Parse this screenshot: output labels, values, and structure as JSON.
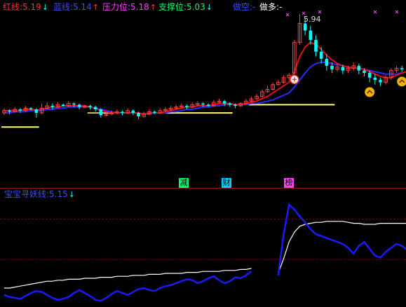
{
  "top_legend": {
    "red_line": {
      "label": "红线:",
      "value": "5.19",
      "arrow": "↓",
      "color": "#ff3030"
    },
    "blue_line": {
      "label": "蓝线:",
      "value": "5.14",
      "arrow": "↑",
      "color": "#3b4bff"
    },
    "resistance": {
      "label": "压力位:",
      "value": "5.18",
      "arrow": "↑",
      "color": "#ff40ff"
    },
    "support": {
      "label": "支撑位:",
      "value": "5.03",
      "arrow": "↓",
      "color": "#00ff66"
    },
    "short": {
      "label": "做空:",
      "value": "-",
      "color": "#3b4bff"
    },
    "long": {
      "label": "做多:",
      "value": "-",
      "color": "#ffffff"
    }
  },
  "peak_price": "5.94",
  "tags": [
    {
      "text": "减",
      "bg": "#00ff66"
    },
    {
      "text": "财",
      "bg": "#00cfff"
    },
    {
      "text": "榜",
      "bg": "#ff40ff"
    }
  ],
  "sub_legend": {
    "label": "宝宝寻妖线:",
    "value": "5.15",
    "arrow": "↓",
    "color": "#00ffff"
  },
  "colors": {
    "background": "#000000",
    "divider": "#8a1a1a",
    "up": "#ff4040",
    "down": "#00ffff",
    "flat": "#ffffff"
  },
  "chart_data": {
    "type": "candlestick",
    "title": "",
    "xlabel": "",
    "ylabel": "",
    "ylim": [
      4.6,
      6.0
    ],
    "candles": [
      {
        "o": 5.1,
        "c": 5.12,
        "h": 5.14,
        "l": 5.08
      },
      {
        "o": 5.12,
        "c": 5.11,
        "h": 5.13,
        "l": 5.09
      },
      {
        "o": 5.11,
        "c": 5.13,
        "h": 5.15,
        "l": 5.1
      },
      {
        "o": 5.13,
        "c": 5.12,
        "h": 5.14,
        "l": 5.1
      },
      {
        "o": 5.12,
        "c": 5.14,
        "h": 5.16,
        "l": 5.11
      },
      {
        "o": 5.14,
        "c": 5.13,
        "h": 5.15,
        "l": 5.12
      },
      {
        "o": 5.13,
        "c": 5.1,
        "h": 5.14,
        "l": 5.06
      },
      {
        "o": 5.1,
        "c": 5.14,
        "h": 5.18,
        "l": 5.09
      },
      {
        "o": 5.14,
        "c": 5.16,
        "h": 5.19,
        "l": 5.13
      },
      {
        "o": 5.16,
        "c": 5.15,
        "h": 5.18,
        "l": 5.13
      },
      {
        "o": 5.15,
        "c": 5.17,
        "h": 5.19,
        "l": 5.14
      },
      {
        "o": 5.17,
        "c": 5.16,
        "h": 5.18,
        "l": 5.15
      },
      {
        "o": 5.16,
        "c": 5.18,
        "h": 5.2,
        "l": 5.15
      },
      {
        "o": 5.18,
        "c": 5.17,
        "h": 5.19,
        "l": 5.15
      },
      {
        "o": 5.17,
        "c": 5.15,
        "h": 5.18,
        "l": 5.13
      },
      {
        "o": 5.15,
        "c": 5.16,
        "h": 5.17,
        "l": 5.14
      },
      {
        "o": 5.16,
        "c": 5.15,
        "h": 5.17,
        "l": 5.13
      },
      {
        "o": 5.15,
        "c": 5.13,
        "h": 5.16,
        "l": 5.11
      },
      {
        "o": 5.13,
        "c": 5.08,
        "h": 5.14,
        "l": 5.06
      },
      {
        "o": 5.08,
        "c": 5.09,
        "h": 5.11,
        "l": 5.07
      },
      {
        "o": 5.09,
        "c": 5.1,
        "h": 5.12,
        "l": 5.08
      },
      {
        "o": 5.1,
        "c": 5.11,
        "h": 5.13,
        "l": 5.09
      },
      {
        "o": 5.11,
        "c": 5.1,
        "h": 5.12,
        "l": 5.08
      },
      {
        "o": 5.1,
        "c": 5.12,
        "h": 5.14,
        "l": 5.09
      },
      {
        "o": 5.12,
        "c": 5.1,
        "h": 5.13,
        "l": 5.08
      },
      {
        "o": 5.1,
        "c": 5.07,
        "h": 5.11,
        "l": 5.05
      },
      {
        "o": 5.07,
        "c": 5.09,
        "h": 5.11,
        "l": 5.06
      },
      {
        "o": 5.09,
        "c": 5.11,
        "h": 5.13,
        "l": 5.08
      },
      {
        "o": 5.11,
        "c": 5.1,
        "h": 5.12,
        "l": 5.09
      },
      {
        "o": 5.1,
        "c": 5.12,
        "h": 5.14,
        "l": 5.09
      },
      {
        "o": 5.12,
        "c": 5.13,
        "h": 5.15,
        "l": 5.11
      },
      {
        "o": 5.13,
        "c": 5.14,
        "h": 5.16,
        "l": 5.12
      },
      {
        "o": 5.14,
        "c": 5.15,
        "h": 5.17,
        "l": 5.13
      },
      {
        "o": 5.15,
        "c": 5.16,
        "h": 5.18,
        "l": 5.14
      },
      {
        "o": 5.16,
        "c": 5.15,
        "h": 5.17,
        "l": 5.13
      },
      {
        "o": 5.15,
        "c": 5.17,
        "h": 5.19,
        "l": 5.14
      },
      {
        "o": 5.17,
        "c": 5.18,
        "h": 5.2,
        "l": 5.16
      },
      {
        "o": 5.18,
        "c": 5.17,
        "h": 5.19,
        "l": 5.15
      },
      {
        "o": 5.17,
        "c": 5.16,
        "h": 5.18,
        "l": 5.15
      },
      {
        "o": 5.16,
        "c": 5.19,
        "h": 5.21,
        "l": 5.15
      },
      {
        "o": 5.19,
        "c": 5.2,
        "h": 5.22,
        "l": 5.18
      },
      {
        "o": 5.2,
        "c": 5.18,
        "h": 5.21,
        "l": 5.16
      },
      {
        "o": 5.18,
        "c": 5.17,
        "h": 5.19,
        "l": 5.15
      },
      {
        "o": 5.17,
        "c": 5.16,
        "h": 5.18,
        "l": 5.14
      },
      {
        "o": 5.16,
        "c": 5.18,
        "h": 5.19,
        "l": 5.15
      },
      {
        "o": 5.18,
        "c": 5.2,
        "h": 5.22,
        "l": 5.17
      },
      {
        "o": 5.2,
        "c": 5.22,
        "h": 5.24,
        "l": 5.19
      },
      {
        "o": 5.22,
        "c": 5.24,
        "h": 5.26,
        "l": 5.21
      },
      {
        "o": 5.24,
        "c": 5.28,
        "h": 5.3,
        "l": 5.23
      },
      {
        "o": 5.28,
        "c": 5.3,
        "h": 5.33,
        "l": 5.27
      },
      {
        "o": 5.3,
        "c": 5.34,
        "h": 5.36,
        "l": 5.29
      },
      {
        "o": 5.34,
        "c": 5.36,
        "h": 5.38,
        "l": 5.33
      },
      {
        "o": 5.36,
        "c": 5.4,
        "h": 5.42,
        "l": 5.35
      },
      {
        "o": 5.4,
        "c": 5.42,
        "h": 5.44,
        "l": 5.38
      },
      {
        "o": 5.44,
        "c": 5.7,
        "h": 5.72,
        "l": 5.42
      },
      {
        "o": 5.7,
        "c": 5.86,
        "h": 5.94,
        "l": 5.68
      },
      {
        "o": 5.86,
        "c": 5.8,
        "h": 5.9,
        "l": 5.76
      },
      {
        "o": 5.8,
        "c": 5.72,
        "h": 5.84,
        "l": 5.68
      },
      {
        "o": 5.72,
        "c": 5.62,
        "h": 5.76,
        "l": 5.58
      },
      {
        "o": 5.62,
        "c": 5.56,
        "h": 5.66,
        "l": 5.52
      },
      {
        "o": 5.56,
        "c": 5.5,
        "h": 5.6,
        "l": 5.46
      },
      {
        "o": 5.5,
        "c": 5.47,
        "h": 5.53,
        "l": 5.44
      },
      {
        "o": 5.47,
        "c": 5.49,
        "h": 5.52,
        "l": 5.45
      },
      {
        "o": 5.49,
        "c": 5.46,
        "h": 5.51,
        "l": 5.43
      },
      {
        "o": 5.46,
        "c": 5.48,
        "h": 5.5,
        "l": 5.44
      },
      {
        "o": 5.48,
        "c": 5.5,
        "h": 5.53,
        "l": 5.46
      },
      {
        "o": 5.5,
        "c": 5.46,
        "h": 5.52,
        "l": 5.43
      },
      {
        "o": 5.46,
        "c": 5.44,
        "h": 5.48,
        "l": 5.41
      },
      {
        "o": 5.44,
        "c": 5.4,
        "h": 5.46,
        "l": 5.36
      },
      {
        "o": 5.4,
        "c": 5.38,
        "h": 5.43,
        "l": 5.34
      },
      {
        "o": 5.38,
        "c": 5.36,
        "h": 5.4,
        "l": 5.33
      },
      {
        "o": 5.36,
        "c": 5.4,
        "h": 5.42,
        "l": 5.34
      },
      {
        "o": 5.4,
        "c": 5.46,
        "h": 5.48,
        "l": 5.38
      },
      {
        "o": 5.46,
        "c": 5.48,
        "h": 5.5,
        "l": 5.44
      },
      {
        "o": 5.48,
        "c": 5.47,
        "h": 5.5,
        "l": 5.45
      }
    ],
    "red_line": [
      5.12,
      5.12,
      5.12,
      5.12,
      5.13,
      5.13,
      5.12,
      5.13,
      5.14,
      5.15,
      5.15,
      5.16,
      5.16,
      5.16,
      5.16,
      5.16,
      5.15,
      5.14,
      5.12,
      5.11,
      5.1,
      5.1,
      5.1,
      5.1,
      5.1,
      5.1,
      5.09,
      5.1,
      5.1,
      5.1,
      5.11,
      5.12,
      5.13,
      5.14,
      5.15,
      5.15,
      5.16,
      5.16,
      5.16,
      5.17,
      5.18,
      5.18,
      5.18,
      5.17,
      5.17,
      5.18,
      5.19,
      5.2,
      5.22,
      5.24,
      5.27,
      5.3,
      5.33,
      5.36,
      5.45,
      5.58,
      5.66,
      5.7,
      5.68,
      5.64,
      5.59,
      5.55,
      5.52,
      5.5,
      5.49,
      5.48,
      5.48,
      5.47,
      5.45,
      5.43,
      5.41,
      5.4,
      5.4,
      5.42,
      5.44,
      5.45
    ],
    "blue_line": [
      5.1,
      5.1,
      5.11,
      5.11,
      5.11,
      5.12,
      5.12,
      5.12,
      5.13,
      5.13,
      5.14,
      5.14,
      5.15,
      5.15,
      5.15,
      5.15,
      5.15,
      5.14,
      5.13,
      5.12,
      5.11,
      5.1,
      5.1,
      5.1,
      5.1,
      5.1,
      5.09,
      5.09,
      5.1,
      5.1,
      5.1,
      5.11,
      5.11,
      5.12,
      5.13,
      5.13,
      5.14,
      5.15,
      5.15,
      5.16,
      5.16,
      5.17,
      5.17,
      5.17,
      5.17,
      5.17,
      5.18,
      5.18,
      5.19,
      5.2,
      5.21,
      5.23,
      5.25,
      5.27,
      5.32,
      5.38,
      5.44,
      5.49,
      5.52,
      5.53,
      5.53,
      5.52,
      5.51,
      5.5,
      5.49,
      5.48,
      5.48,
      5.47,
      5.46,
      5.45,
      5.44,
      5.43,
      5.43,
      5.43,
      5.44,
      5.45
    ],
    "support_segments": [
      {
        "from": 0,
        "to": 6,
        "value": 4.98
      },
      {
        "from": 30,
        "to": 42,
        "value": 5.1
      },
      {
        "from": 46,
        "to": 61,
        "value": 5.17
      }
    ],
    "resistance_segments": [
      {
        "from": 16,
        "to": 22,
        "value": 5.1
      }
    ],
    "signals": [
      {
        "index": 54,
        "type": "buy-circle"
      },
      {
        "index": 68,
        "type": "short-chevron"
      },
      {
        "index": 74,
        "type": "short-chevron"
      }
    ],
    "sub_chart": {
      "white_line": [
        0.15,
        0.15,
        0.16,
        0.17,
        0.18,
        0.19,
        0.2,
        0.21,
        0.22,
        0.22,
        0.23,
        0.23,
        0.24,
        0.24,
        0.24,
        0.25,
        0.25,
        0.25,
        0.26,
        0.26,
        0.26,
        0.27,
        0.27,
        0.27,
        0.28,
        0.28,
        0.28,
        0.29,
        0.29,
        0.29,
        0.3,
        0.3,
        0.3,
        0.3,
        0.31,
        0.31,
        0.31,
        0.32,
        0.32,
        0.32,
        0.32,
        0.33,
        0.33,
        0.33,
        0.34,
        0.34,
        0.35,
        null,
        null,
        null,
        null,
        0.3,
        0.45,
        0.62,
        0.72,
        0.78,
        0.8,
        0.81,
        0.82,
        0.82,
        0.83,
        0.83,
        0.83,
        0.83,
        0.82,
        0.81,
        0.81,
        0.8,
        0.8,
        0.8,
        0.81,
        0.81,
        0.81,
        0.81,
        0.81,
        0.81
      ],
      "blue_line": [
        0.08,
        0.06,
        0.05,
        0.04,
        0.07,
        0.1,
        0.12,
        0.11,
        0.08,
        0.05,
        0.03,
        0.04,
        0.06,
        0.1,
        0.13,
        0.1,
        0.07,
        0.03,
        0.02,
        0.05,
        0.09,
        0.12,
        0.1,
        0.08,
        0.11,
        0.14,
        0.15,
        0.13,
        0.12,
        0.15,
        0.17,
        0.18,
        0.2,
        0.22,
        0.24,
        0.23,
        0.2,
        0.22,
        0.25,
        0.27,
        0.23,
        0.2,
        0.22,
        0.26,
        0.25,
        0.28,
        0.32,
        null,
        null,
        null,
        null,
        0.28,
        0.7,
        1.0,
        0.95,
        0.88,
        0.82,
        0.75,
        0.7,
        0.68,
        0.66,
        0.64,
        0.62,
        0.6,
        0.56,
        0.5,
        0.58,
        0.62,
        0.55,
        0.48,
        0.46,
        0.52,
        0.56,
        0.6,
        0.58,
        0.54
      ]
    }
  }
}
